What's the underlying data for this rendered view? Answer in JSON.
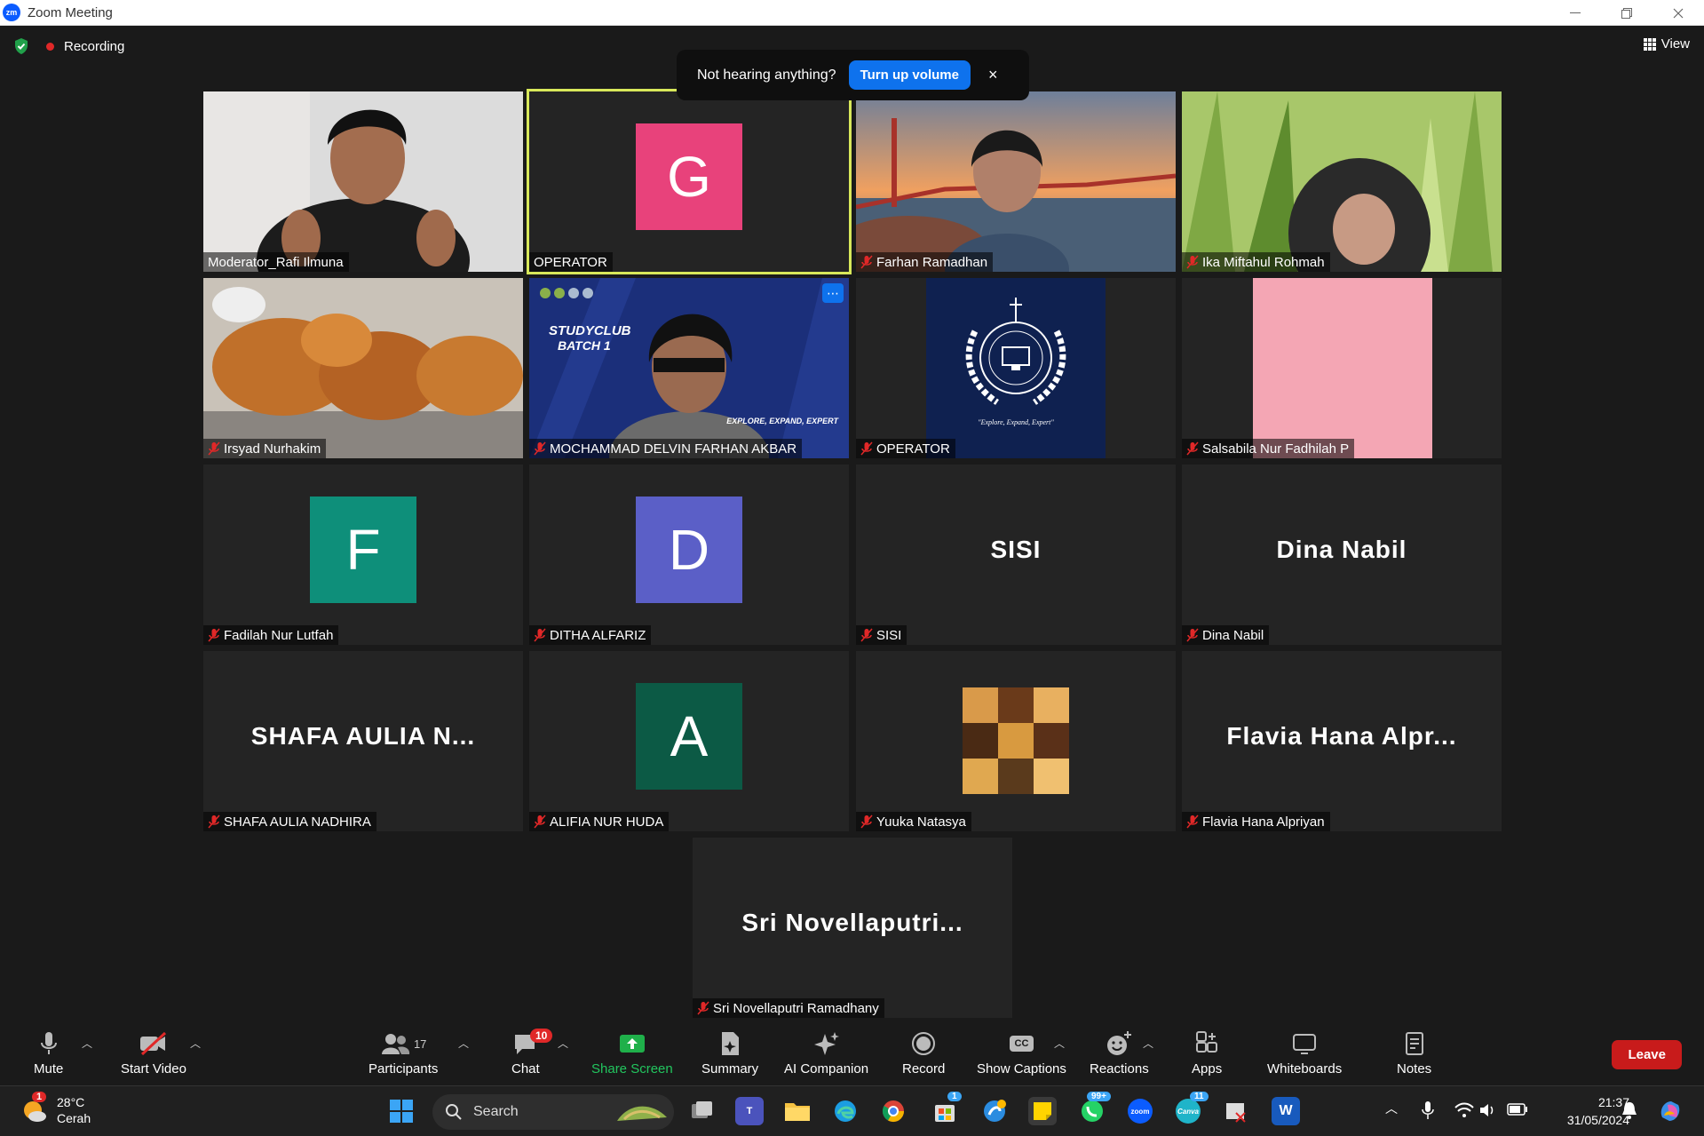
{
  "window": {
    "title": "Zoom Meeting",
    "app_icon_text": "zm"
  },
  "status": {
    "recording_label": "Recording",
    "view_label": "View"
  },
  "notice": {
    "text": "Not hearing anything?",
    "button": "Turn up volume",
    "close": "×"
  },
  "tiles": [
    {
      "name": "Moderator_Rafi Ilmuna",
      "type": "video",
      "muted": false
    },
    {
      "name": "OPERATOR",
      "type": "avatar",
      "initial": "G",
      "color": "#e8427b",
      "muted": false,
      "active": true
    },
    {
      "name": "Farhan Ramadhan",
      "type": "video",
      "muted": true
    },
    {
      "name": "Ika Miftahul Rohmah",
      "type": "video",
      "muted": true
    },
    {
      "name": "Irsyad Nurhakim",
      "type": "video",
      "muted": true
    },
    {
      "name": "MOCHAMMAD DELVIN FARHAN AKBAR",
      "type": "video",
      "muted": true,
      "overlay": {
        "line1": "STUDYCLUB",
        "line2": "BATCH 1",
        "line3": "EXPLORE, EXPAND, EXPERT"
      }
    },
    {
      "name": "OPERATOR",
      "type": "logo",
      "muted": true,
      "caption": "\"Explore, Expand, Expert\""
    },
    {
      "name": "Salsabila Nur Fadhilah P",
      "type": "picture",
      "muted": true
    },
    {
      "name": "Fadilah Nur Lutfah",
      "type": "avatar",
      "initial": "F",
      "color": "#0e8f7a",
      "muted": true
    },
    {
      "name": "DITHA ALFARIZ",
      "type": "avatar",
      "initial": "D",
      "color": "#5b5fc7",
      "muted": true
    },
    {
      "name": "SISI",
      "type": "text",
      "display": "SISI",
      "muted": true
    },
    {
      "name": "Dina Nabil",
      "type": "text",
      "display": "Dina Nabil",
      "muted": true
    },
    {
      "name": "SHAFA AULIA NADHIRA",
      "type": "text",
      "display": "SHAFA AULIA N...",
      "muted": true
    },
    {
      "name": "ALIFIA NUR HUDA",
      "type": "avatar",
      "initial": "A",
      "color": "#0c5a45",
      "muted": true
    },
    {
      "name": "Yuuka Natasya",
      "type": "picture",
      "muted": true
    },
    {
      "name": "Flavia Hana Alpriyan",
      "type": "text",
      "display": "Flavia Hana Alpr...",
      "muted": true
    },
    {
      "name": "Sri Novellaputri Ramadhany",
      "type": "text",
      "display": "Sri Novellaputri...",
      "muted": true
    }
  ],
  "toolbar": {
    "mute": "Mute",
    "start_video": "Start Video",
    "participants": "Participants",
    "participants_count": "17",
    "chat": "Chat",
    "chat_badge": "10",
    "share_screen": "Share Screen",
    "summary": "Summary",
    "ai_companion": "AI Companion",
    "record": "Record",
    "show_captions": "Show Captions",
    "captions_icon": "CC",
    "reactions": "Reactions",
    "apps": "Apps",
    "whiteboards": "Whiteboards",
    "notes": "Notes",
    "leave": "Leave"
  },
  "taskbar": {
    "weather_temp": "28°C",
    "weather_desc": "Cerah",
    "weather_badge": "1",
    "search": "Search",
    "whatsapp_badge": "99+",
    "canva_badge": "11",
    "store_badge": "1",
    "zoom_label": "zoom",
    "canva_label": "Canva",
    "word_label": "W",
    "time": "21:37",
    "date": "31/05/2024"
  }
}
